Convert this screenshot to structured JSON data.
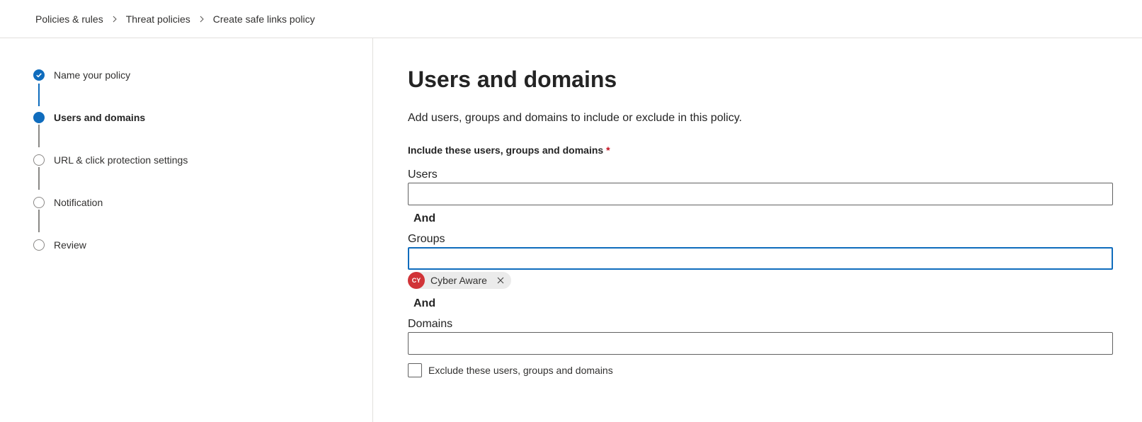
{
  "breadcrumb": {
    "items": [
      "Policies & rules",
      "Threat policies",
      "Create safe links policy"
    ]
  },
  "wizard": {
    "steps": [
      {
        "label": "Name your policy",
        "state": "completed"
      },
      {
        "label": "Users and domains",
        "state": "current"
      },
      {
        "label": "URL & click protection settings",
        "state": "pending"
      },
      {
        "label": "Notification",
        "state": "pending"
      },
      {
        "label": "Review",
        "state": "pending"
      }
    ]
  },
  "main": {
    "title": "Users and domains",
    "description": "Add users, groups and domains to include or exclude in this policy.",
    "include_label": "Include these users, groups and domains",
    "required_marker": "*",
    "users_label": "Users",
    "users_value": "",
    "and_label_1": "And",
    "groups_label": "Groups",
    "groups_value": "",
    "groups_selected": [
      {
        "initials": "CY",
        "name": "Cyber Aware",
        "avatar_color": "#d13438"
      }
    ],
    "and_label_2": "And",
    "domains_label": "Domains",
    "domains_value": "",
    "exclude_label": "Exclude these users, groups and domains",
    "exclude_checked": false
  },
  "colors": {
    "accent": "#0f6cbd",
    "required": "#c50f1f",
    "chip_avatar": "#d13438"
  },
  "icons": {
    "breadcrumb_separator": "chevron-right-icon",
    "completed_step": "checkmark-icon",
    "chip_remove": "dismiss-icon"
  }
}
